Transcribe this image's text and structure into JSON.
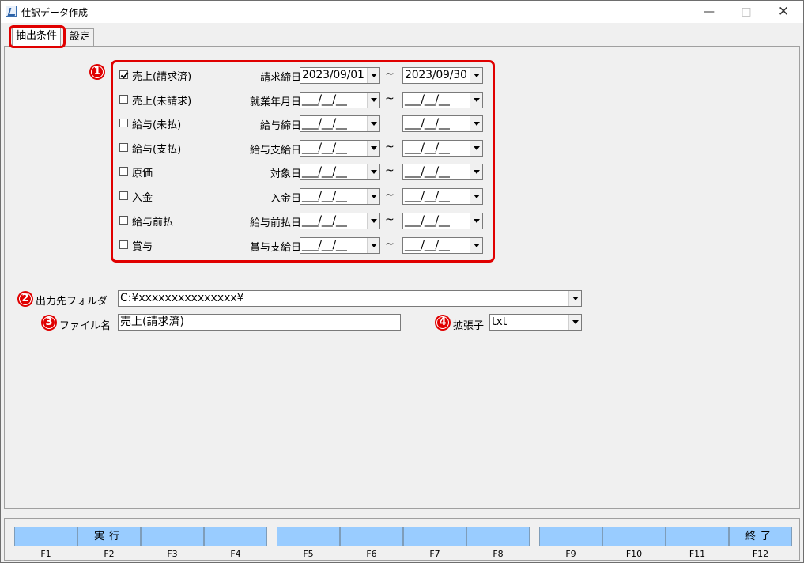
{
  "window": {
    "title": "仕訳データ作成",
    "minimize_glyph": "—",
    "maximize_glyph": "□",
    "close_glyph": "✕"
  },
  "tabs": [
    {
      "label": "抽出条件",
      "active": true
    },
    {
      "label": "設定",
      "active": false
    }
  ],
  "annotations": {
    "n1": "1",
    "n2": "2",
    "n3": "3",
    "n4": "4"
  },
  "conditions": [
    {
      "label": "売上(請求済)",
      "checked": true,
      "date_label": "請求締日",
      "from": "2023/09/01",
      "to": "2023/09/30",
      "tilde": "~"
    },
    {
      "label": "売上(未請求)",
      "checked": false,
      "date_label": "就業年月日",
      "from": "___/__/__",
      "to": "___/__/__",
      "tilde": "~"
    },
    {
      "label": "給与(未払)",
      "checked": false,
      "date_label": "給与締日",
      "from": "___/__/__",
      "to": "___/__/__",
      "tilde": ""
    },
    {
      "label": "給与(支払)",
      "checked": false,
      "date_label": "給与支給日",
      "from": "___/__/__",
      "to": "___/__/__",
      "tilde": "~"
    },
    {
      "label": "原価",
      "checked": false,
      "date_label": "対象日",
      "from": "___/__/__",
      "to": "___/__/__",
      "tilde": "~"
    },
    {
      "label": "入金",
      "checked": false,
      "date_label": "入金日",
      "from": "___/__/__",
      "to": "___/__/__",
      "tilde": "~"
    },
    {
      "label": "給与前払",
      "checked": false,
      "date_label": "給与前払日",
      "from": "___/__/__",
      "to": "___/__/__",
      "tilde": "~"
    },
    {
      "label": "賞与",
      "checked": false,
      "date_label": "賞与支給日",
      "from": "___/__/__",
      "to": "___/__/__",
      "tilde": "~"
    }
  ],
  "output": {
    "folder_label": "出力先フォルダ",
    "folder_value": "C:¥xxxxxxxxxxxxxxx¥",
    "filename_label": "ファイル名",
    "filename_value": "売上(請求済)",
    "extension_label": "拡張子",
    "extension_value": "txt"
  },
  "function_keys": [
    {
      "key": "F1",
      "label": ""
    },
    {
      "key": "F2",
      "label": "実行"
    },
    {
      "key": "F3",
      "label": ""
    },
    {
      "key": "F4",
      "label": ""
    },
    {
      "key": "F5",
      "label": ""
    },
    {
      "key": "F6",
      "label": ""
    },
    {
      "key": "F7",
      "label": ""
    },
    {
      "key": "F8",
      "label": ""
    },
    {
      "key": "F9",
      "label": ""
    },
    {
      "key": "F10",
      "label": ""
    },
    {
      "key": "F11",
      "label": ""
    },
    {
      "key": "F12",
      "label": "終了"
    }
  ],
  "colors": {
    "annotation_red": "#e00000",
    "fkey_blue": "#99ccff",
    "panel_bg": "#f0f0f0"
  }
}
